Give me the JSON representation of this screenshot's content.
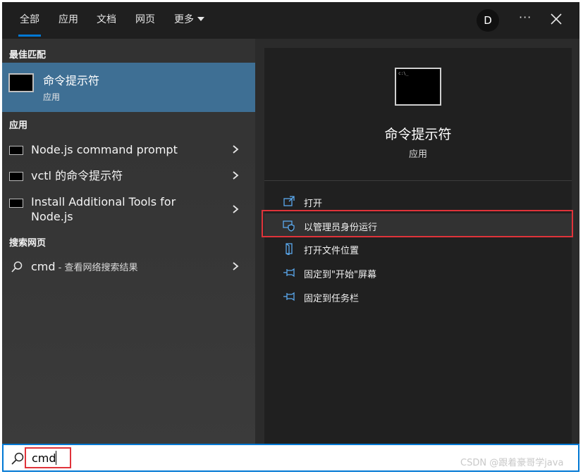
{
  "tabs": [
    "全部",
    "应用",
    "文档",
    "网页",
    "更多"
  ],
  "account": {
    "initial": "D"
  },
  "more_options": "···",
  "sections": {
    "best_match": "最佳匹配",
    "apps": "应用",
    "web": "搜索网页"
  },
  "best_match": {
    "title": "命令提示符",
    "subtitle": "应用"
  },
  "apps": [
    {
      "label": "Node.js command prompt"
    },
    {
      "label": "vctl 的命令提示符"
    },
    {
      "label": "Install Additional Tools for Node.js"
    }
  ],
  "web_result": {
    "query": "cmd",
    "suffix": " - 查看网络搜索结果"
  },
  "preview": {
    "title": "命令提示符",
    "subtitle": "应用",
    "icon_text": "c:\\_"
  },
  "actions": [
    {
      "label": "打开",
      "icon": "open-icon"
    },
    {
      "label": "以管理员身份运行",
      "icon": "shield-icon"
    },
    {
      "label": "打开文件位置",
      "icon": "folder-icon"
    },
    {
      "label": "固定到\"开始\"屏幕",
      "icon": "pin-icon"
    },
    {
      "label": "固定到任务栏",
      "icon": "pin-icon"
    }
  ],
  "search": {
    "query": "cmd"
  },
  "watermark": "CSDN @跟着豪哥学java",
  "colors": {
    "accent": "#0078d4",
    "selection": "#3e6f94",
    "highlight_box": "#e0333a"
  }
}
